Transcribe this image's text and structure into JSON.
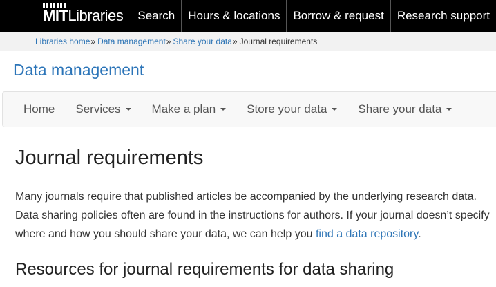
{
  "header": {
    "logo_mit": "MIT",
    "logo_libraries": "Libraries",
    "nav": [
      {
        "label": "Search"
      },
      {
        "label": "Hours & locations"
      },
      {
        "label": "Borrow & request"
      },
      {
        "label": "Research support"
      }
    ]
  },
  "breadcrumb": {
    "items": [
      {
        "label": "Libraries home"
      },
      {
        "label": "Data management"
      },
      {
        "label": "Share your data"
      }
    ],
    "separator": "»",
    "current": "Journal requirements"
  },
  "section": {
    "title": "Data management"
  },
  "subnav": {
    "items": [
      {
        "label": "Home"
      },
      {
        "label": "Services"
      },
      {
        "label": "Make a plan"
      },
      {
        "label": "Store your data"
      },
      {
        "label": "Share your data"
      }
    ]
  },
  "main": {
    "title": "Journal requirements",
    "intro_line1": "Many journals require that published articles be accompanied by the underlying research data.",
    "intro_line2": "Data sharing policies often are found in the instructions for authors. If your journal doesn’t specify",
    "intro_line3_before": "where and how you should share your data, we can help you ",
    "intro_link": "find a data repository",
    "intro_line3_after": ".",
    "subheading": "Resources for journal requirements for data sharing"
  },
  "colors": {
    "topbar": "#000000",
    "link": "#2e75b6",
    "section_title": "#2b74b8"
  }
}
